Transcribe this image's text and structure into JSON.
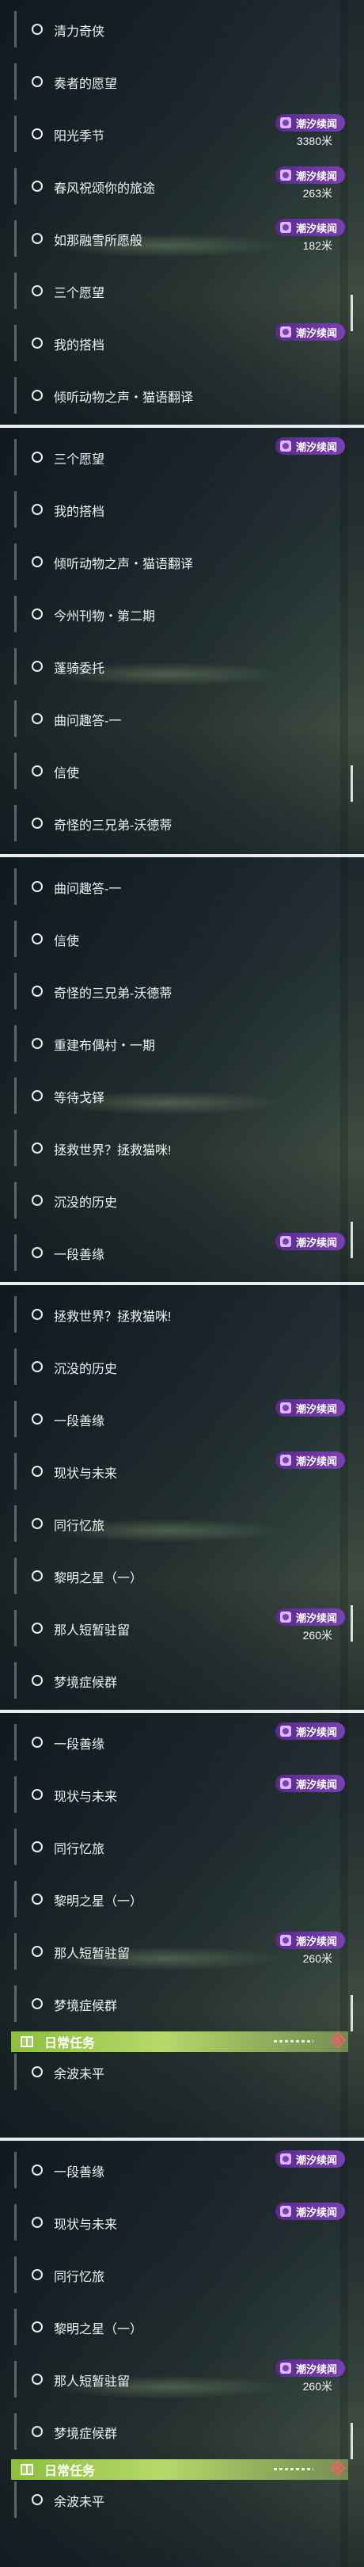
{
  "tag_label": "潮汐续闻",
  "daily_label": "日常任务",
  "screens": [
    {
      "items": [
        "清力奇侠",
        "奏者的愿望",
        "阳光季节",
        "春风祝颂你的旅途",
        "如那融雪所愿般",
        "三个愿望",
        "我的搭档",
        "倾听动物之声・猫语翻译"
      ],
      "tags": [
        {
          "row": 2,
          "dist": "3380米"
        },
        {
          "row": 3,
          "dist": "263米"
        },
        {
          "row": 4,
          "dist": "182米"
        },
        {
          "row": 6,
          "dist": ""
        }
      ]
    },
    {
      "items": [
        "三个愿望",
        "我的搭档",
        "倾听动物之声・猫语翻译",
        "今州刊物・第二期",
        "蓬骑委托",
        "曲问趣答-一",
        "信使",
        "奇怪的三兄弟-沃德蒂"
      ],
      "tags": [
        {
          "row": 0,
          "dist": ""
        }
      ]
    },
    {
      "items": [
        "曲问趣答-一",
        "信使",
        "奇怪的三兄弟-沃德蒂",
        "重建布偶村・一期",
        "等待戈铎",
        "拯救世界？拯救猫咪!",
        "沉没的历史",
        "一段善缘"
      ],
      "tags": [
        {
          "row": 7,
          "dist": ""
        }
      ]
    },
    {
      "items": [
        "拯救世界？拯救猫咪!",
        "沉没的历史",
        "一段善缘",
        "现状与未来",
        "同行忆旅",
        "黎明之星（一）",
        "那人短暂驻留",
        "梦境症候群"
      ],
      "tags": [
        {
          "row": 2,
          "dist": ""
        },
        {
          "row": 3,
          "dist": ""
        },
        {
          "row": 6,
          "dist": "260米"
        }
      ]
    },
    {
      "items": [
        "一段善缘",
        "现状与未来",
        "同行忆旅",
        "黎明之星（一）",
        "那人短暂驻留",
        "梦境症候群"
      ],
      "tags": [
        {
          "row": 0,
          "dist": ""
        },
        {
          "row": 1,
          "dist": ""
        },
        {
          "row": 4,
          "dist": "260米"
        }
      ],
      "daily_items": [
        "余波未平"
      ]
    },
    {
      "items": [
        "一段善缘",
        "现状与未来",
        "同行忆旅",
        "黎明之星（一）",
        "那人短暂驻留",
        "梦境症候群"
      ],
      "tags": [
        {
          "row": 0,
          "dist": ""
        },
        {
          "row": 1,
          "dist": ""
        },
        {
          "row": 4,
          "dist": "260米"
        }
      ],
      "daily_items": [
        "余波未平"
      ]
    }
  ]
}
